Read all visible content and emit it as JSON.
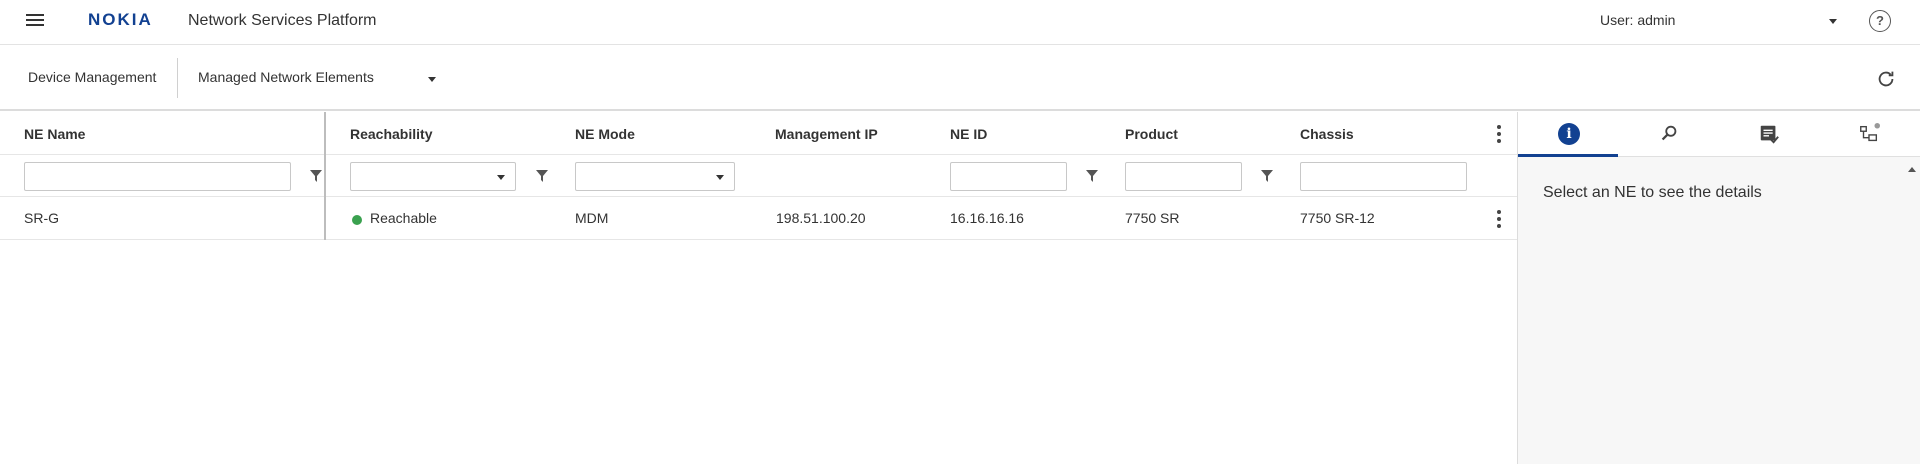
{
  "header": {
    "menu_icon": "hamburger-icon",
    "logo": "NOKIA",
    "title": "Network Services Platform",
    "user": "User: admin",
    "help_icon": "help-circle-icon"
  },
  "toolbar": {
    "breadcrumb": "Device Management",
    "view": "Managed Network Elements",
    "refresh_icon": "refresh-icon"
  },
  "table": {
    "columns": [
      "NE Name",
      "Reachability",
      "NE Mode",
      "Management IP",
      "NE ID",
      "Product",
      "Chassis"
    ],
    "rows": [
      {
        "ne_name": "SR-G",
        "reachability": "Reachable",
        "ne_mode": "MDM",
        "management_ip": "198.51.100.20",
        "ne_id": "16.16.16.16",
        "product": "7750 SR",
        "chassis": "7750 SR-12"
      }
    ],
    "status_color": "#3aa14f"
  },
  "panel": {
    "tabs": [
      "info-icon",
      "search-icon",
      "checklist-icon",
      "topology-icon"
    ],
    "message": "Select an NE to see the details"
  },
  "colors": {
    "brand": "#124191"
  }
}
